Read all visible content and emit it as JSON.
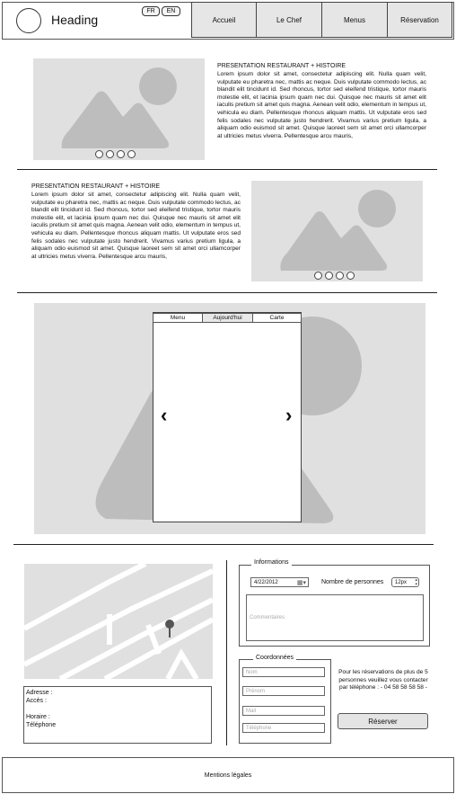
{
  "header": {
    "heading": "Heading",
    "lang_fr": "FR",
    "lang_en": "EN",
    "nav": [
      "Accueil",
      "Le Chef",
      "Menus",
      "Réservation"
    ]
  },
  "section1": {
    "title": "PRESENTATION RESTAURANT + HISTOIRE",
    "body": "Lorem ipsum dolor sit amet, consectetur adipiscing elit. Nulla quam velit, vulputate eu pharetra nec, mattis ac neque. Duis vulputate commodo lectus, ac blandit elit tincidunt id. Sed rhoncus, tortor sed eleifend tristique, tortor mauris molestie elit, et lacinia ipsum quam nec dui. Quisque nec mauris sit amet elit iaculis pretium sit amet quis magna. Aenean velit odio, elementum in tempus ut, vehicula eu diam. Pellentesque rhoncus aliquam mattis. Ut vulputate eros sed felis sodales nec vulputate justo hendrerit. Vivamus varius pretium ligula, a aliquam odio euismod sit amet. Quisque laoreet sem sit amet orci ullamcorper at ultricies metus viverra. Pellentesque arcu mauris,"
  },
  "section2": {
    "title": "PRESENTATION RESTAURANT + HISTOIRE",
    "body": "Lorem ipsum dolor sit amet, consectetur adipiscing elit. Nulla quam velit, vulputate eu pharetra nec, mattis ac neque. Duis vulputate commodo lectus, ac blandit elit tincidunt id. Sed rhoncus, tortor sed eleifend tristique, tortor mauris molestie elit, et lacinia ipsum quam nec dui. Quisque nec mauris sit amet elit iaculis pretium sit amet quis magna. Aenean velit odio, elementum in tempus ut, vehicula eu diam. Pellentesque rhoncus aliquam mattis. Ut vulputate eros sed felis sodales nec vulputate justo hendrerit. Vivamus varius pretium ligula, a aliquam odio euismod sit amet. Quisque laoreet sem sit amet orci ullamcorper at ultricies metus viverra. Pellentesque arcu mauris,"
  },
  "menu_panel": {
    "tabs": [
      "Menu",
      "Aujourd'hui",
      "Carte"
    ],
    "prev": "‹",
    "next": "›"
  },
  "address": {
    "lines": [
      "Adresse :",
      "Accès :",
      "",
      "Horaire :",
      "Téléphone"
    ]
  },
  "informations": {
    "legend": "Informations",
    "date": "4/22/2012",
    "persons_label": "Nombre de personnes",
    "persons_value": "12px",
    "comments_placeholder": "Commentaires"
  },
  "coordonnees": {
    "legend": "Coordonnées",
    "fields": [
      "Nom",
      "Prénom",
      "Mail",
      "Téléphone"
    ]
  },
  "reservation": {
    "note": "Pour les réservations de plus de 5 personnes veuillez vous contacter par téléphone : - 04 58 58 58 58 -",
    "button": "Réserver"
  },
  "footer": {
    "text": "Mentions légales"
  }
}
